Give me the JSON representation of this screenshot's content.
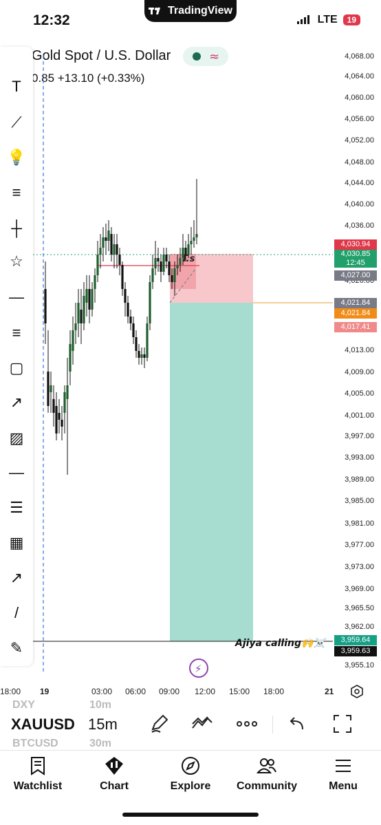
{
  "status_bar": {
    "time": "12:32",
    "app_pill": "TradingView",
    "network": "LTE",
    "battery": "19"
  },
  "header": {
    "symbol_title": "Gold Spot / U.S. Dollar",
    "price_change": "0.85  +13.10 (+0.33%)"
  },
  "toolbar": {
    "tools": [
      "text-tool-icon",
      "trend-line-icon",
      "idea-bulb-icon",
      "long-position-icon",
      "vertical-line-icon",
      "favorite-star-icon",
      "horizontal-ray-icon",
      "short-position-icon",
      "rectangle-icon",
      "arrow-line-icon",
      "image-icon",
      "horizontal-line-icon",
      "parallel-channel-icon",
      "grid-icon",
      "arrow-marker-icon",
      "line-icon",
      "brush-icon"
    ]
  },
  "chart_data": {
    "type": "candlestick",
    "symbol": "XAUUSD",
    "interval": "15m",
    "y_ticks": [
      "4,068.00",
      "4,064.00",
      "4,060.00",
      "4,056.00",
      "4,052.00",
      "4,048.00",
      "4,044.00",
      "4,040.00",
      "4,036.00",
      "4,026.00",
      "4,013.00",
      "4,009.00",
      "4,005.00",
      "4,001.00",
      "3,997.00",
      "3,993.00",
      "3,989.00",
      "3,985.00",
      "3,981.00",
      "3,977.00",
      "3,973.00",
      "3,969.00",
      "3,965.50",
      "3,962.00",
      "3,955.10"
    ],
    "x_ticks": [
      "18:00",
      "19",
      "03:00",
      "06:00",
      "09:00",
      "12:00",
      "15:00",
      "18:00",
      "21"
    ],
    "price_tags": [
      {
        "value": "4,030.94",
        "color": "#e0384a"
      },
      {
        "value": "4,030.85",
        "sub": "12:45",
        "color": "#22a06b"
      },
      {
        "value": "4,027.00",
        "color": "#787b86"
      },
      {
        "value": "4,021.84",
        "color": "#787b86"
      },
      {
        "value": "4,021.84",
        "color": "#f28c18"
      },
      {
        "value": "4,017.41",
        "color": "#f08a8a"
      },
      {
        "value": "3,959.64",
        "color": "#16a085"
      },
      {
        "value": "3,959.63",
        "color": "#111111"
      }
    ],
    "annotations": {
      "stop_label": "T.s",
      "target_label": "Ajiya calling🙌☠️"
    },
    "colors": {
      "up": "#1f5f2e",
      "down": "#111111",
      "stop_zone": "#f7c7cc",
      "target_zone": "#a6ddd0",
      "entry_line": "#f2b15a",
      "stop_line": "#e0384a"
    }
  },
  "bottom_bar": {
    "symbol": "XAUUSD",
    "interval": "15m",
    "ghost_symbols": [
      "DXY",
      "BTCUSD"
    ],
    "ghost_intervals": [
      "10m",
      "30m"
    ]
  },
  "nav": {
    "tabs": [
      {
        "label": "Watchlist",
        "icon": "watchlist-icon"
      },
      {
        "label": "Chart",
        "icon": "chart-icon"
      },
      {
        "label": "Explore",
        "icon": "compass-icon"
      },
      {
        "label": "Community",
        "icon": "community-icon"
      },
      {
        "label": "Menu",
        "icon": "menu-icon"
      }
    ]
  }
}
